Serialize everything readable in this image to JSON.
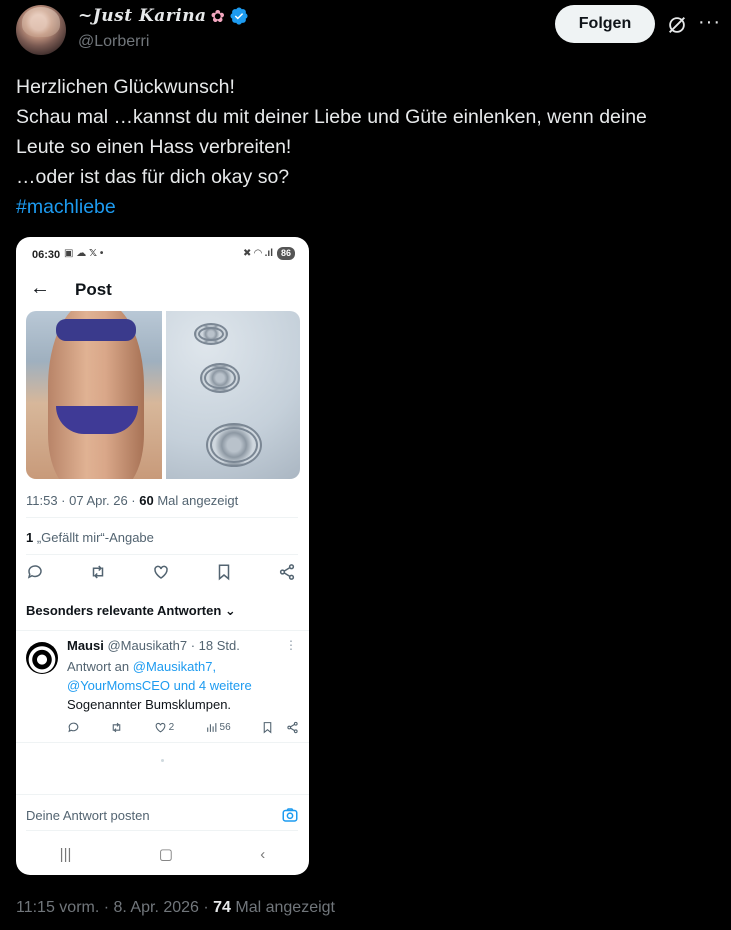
{
  "author": {
    "display_name": "~Just Karina",
    "handle": "@Lorberri"
  },
  "header": {
    "follow_label": "Folgen",
    "more_label": "···"
  },
  "tweet": {
    "lines": [
      "Herzlichen Glückwunsch!",
      "Schau mal …kannst du mit deiner Liebe und Güte einlenken, wenn deine",
      "Leute so einen Hass verbreiten!",
      "…oder ist das für dich okay so?"
    ],
    "hashtag": "#machliebe"
  },
  "screenshot": {
    "status_time": "06:30",
    "status_icons_left": "▣ ☁ 𝕏 •",
    "status_icons_right": "✖ ◠ .ıl",
    "battery": "86",
    "title": "Post",
    "meta_time": "11:53 · 07 Apr. 26 · ",
    "meta_views": "60",
    "meta_views_label": " Mal angezeigt",
    "likes_count": "1",
    "likes_label": " „Gefällt mir“-Angabe",
    "sort_label": "Besonders relevante Antworten ⌄",
    "reply": {
      "name": "Mausi",
      "handle_time": " @Mausikath7 · 18 Std.",
      "reply_to_prefix": "Antwort an ",
      "mention_1": "@Mausikath7,",
      "mention_2": "@YourMomsCEO und 4 weitere",
      "text": "Sogenannter Bumsklumpen.",
      "likes": "2",
      "views": "56"
    },
    "reply_placeholder": "Deine Antwort posten"
  },
  "footer": {
    "time": "11:15 vorm. · 8. Apr. 2026 · ",
    "views": "74",
    "views_label": " Mal angezeigt"
  },
  "colors": {
    "background": "#000000",
    "text": "#e7e9ea",
    "muted": "#71767b",
    "link": "#1d9bf0",
    "verified": "#1d9bf0"
  }
}
